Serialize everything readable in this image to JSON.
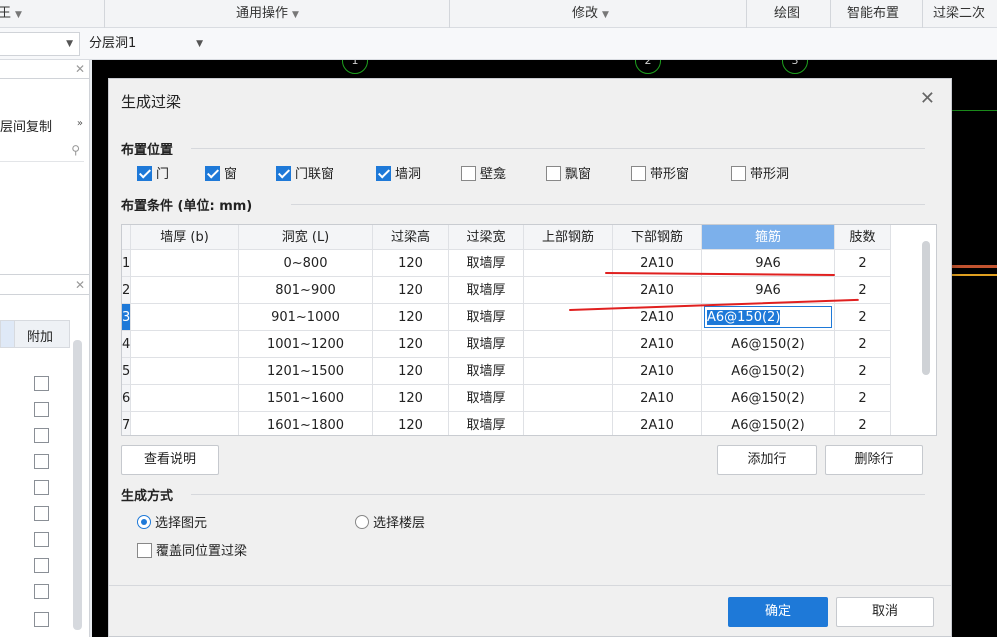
{
  "topbar": {
    "menu_cut": "王",
    "general_ops": "通用操作",
    "modify": "修改",
    "draw": "绘图",
    "smart_place": "智能布置",
    "lintel_cut": "过梁二次"
  },
  "toolbar2": {
    "combo_left_value": "",
    "layer_combo_value": "分层洞1"
  },
  "left_panel": {
    "copy_title": "层间复制",
    "column_header": "附加"
  },
  "canvas": {
    "axis_labels": [
      "1",
      "2",
      "3"
    ]
  },
  "dialog": {
    "title": "生成过梁",
    "section_place": "布置位置",
    "section_cond": "布置条件 (单位: mm)",
    "section_method": "生成方式",
    "checkboxes": [
      {
        "label": "门",
        "checked": true
      },
      {
        "label": "窗",
        "checked": true
      },
      {
        "label": "门联窗",
        "checked": true
      },
      {
        "label": "墙洞",
        "checked": true
      },
      {
        "label": "壁龛",
        "checked": false
      },
      {
        "label": "飘窗",
        "checked": false
      },
      {
        "label": "带形窗",
        "checked": false
      },
      {
        "label": "带形洞",
        "checked": false
      }
    ],
    "table": {
      "headers": [
        "墙厚 (b)",
        "洞宽 (L)",
        "过梁高",
        "过梁宽",
        "上部钢筋",
        "下部钢筋",
        "箍筋",
        "肢数"
      ],
      "rows": [
        {
          "n": "1",
          "wall": "",
          "width": "0~800",
          "h": "120",
          "w": "取墙厚",
          "top": "",
          "bottom": "2A10",
          "stirrup": "9A6",
          "legs": "2"
        },
        {
          "n": "2",
          "wall": "",
          "width": "801~900",
          "h": "120",
          "w": "取墙厚",
          "top": "",
          "bottom": "2A10",
          "stirrup": "9A6",
          "legs": "2"
        },
        {
          "n": "3",
          "wall": "",
          "width": "901~1000",
          "h": "120",
          "w": "取墙厚",
          "top": "",
          "bottom": "2A10",
          "stirrup": "A6@150(2)",
          "legs": "2"
        },
        {
          "n": "4",
          "wall": "",
          "width": "1001~1200",
          "h": "120",
          "w": "取墙厚",
          "top": "",
          "bottom": "2A10",
          "stirrup": "A6@150(2)",
          "legs": "2"
        },
        {
          "n": "5",
          "wall": "",
          "width": "1201~1500",
          "h": "120",
          "w": "取墙厚",
          "top": "",
          "bottom": "2A10",
          "stirrup": "A6@150(2)",
          "legs": "2"
        },
        {
          "n": "6",
          "wall": "",
          "width": "1501~1600",
          "h": "120",
          "w": "取墙厚",
          "top": "",
          "bottom": "2A10",
          "stirrup": "A6@150(2)",
          "legs": "2"
        },
        {
          "n": "7",
          "wall": "",
          "width": "1601~1800",
          "h": "120",
          "w": "取墙厚",
          "top": "",
          "bottom": "2A10",
          "stirrup": "A6@150(2)",
          "legs": "2"
        }
      ]
    },
    "view_notes": "查看说明",
    "add_row": "添加行",
    "delete_row": "删除行",
    "radio_select_element": "选择图元",
    "radio_select_floor": "选择楼层",
    "overwrite_label": "覆盖同位置过梁",
    "ok": "确定",
    "cancel": "取消"
  },
  "colors": {
    "accent": "#1e79d8",
    "selected_header": "#7cb0eb",
    "annotation": "#e02020"
  }
}
